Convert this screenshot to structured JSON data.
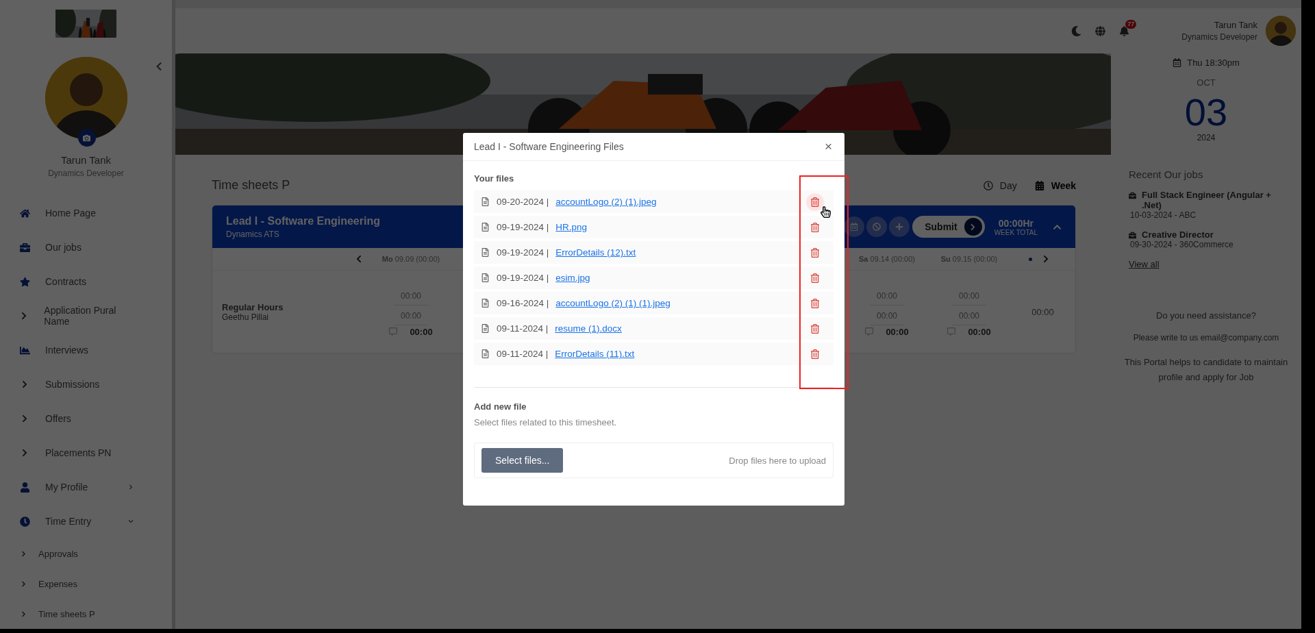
{
  "header": {
    "notification_count": "77",
    "user_name": "Tarun Tank",
    "user_role": "Dynamics Developer"
  },
  "sidebar": {
    "profile_name": "Tarun Tank",
    "profile_role": "Dynamics Developer",
    "items": [
      {
        "label": "Home Page",
        "kind": "home"
      },
      {
        "label": "Our jobs",
        "kind": "briefcase"
      },
      {
        "label": "Contracts",
        "kind": "star"
      },
      {
        "label": "Application Pural Name",
        "kind": "chevron"
      },
      {
        "label": "Interviews",
        "kind": "chart"
      },
      {
        "label": "Submissions",
        "kind": "chevron"
      },
      {
        "label": "Offers",
        "kind": "chevron"
      },
      {
        "label": "Placements PN",
        "kind": "chevron"
      },
      {
        "label": "My Profile",
        "kind": "user",
        "expanded": false
      },
      {
        "label": "Time Entry",
        "kind": "clock",
        "expanded": true,
        "children": [
          {
            "label": "Approvals"
          },
          {
            "label": "Expenses"
          },
          {
            "label": "Time sheets P"
          }
        ]
      }
    ]
  },
  "main": {
    "page_title": "Time sheets P",
    "view_toggle": [
      {
        "label": "Day",
        "selected": false
      },
      {
        "label": "Week",
        "selected": true
      }
    ],
    "timesheet": {
      "title": "Lead I - Software Engineering",
      "subtitle": "Dynamics ATS",
      "submit": "Submit",
      "week_total": "00:00Hr",
      "week_total_label": "WEEK TOTAL",
      "days": [
        {
          "abbr": "Mo",
          "date": "09.09 (00:00)"
        },
        {
          "abbr": "Sa",
          "date": "09.14 (00:00)"
        },
        {
          "abbr": "Su",
          "date": "09.15 (00:00)"
        }
      ],
      "row": {
        "label": "Regular Hours",
        "person": "Geethu Pillai",
        "cells": [
          {
            "start": "00:00",
            "end": "00:00",
            "hours": "00:00"
          },
          {
            "start": "00:00",
            "end": "00:00",
            "hours": "00:00"
          },
          {
            "start": "00:00",
            "end": "00:00",
            "hours": "00:00"
          }
        ],
        "total": "00:00"
      }
    }
  },
  "right_panel": {
    "time": "Thu 18:30pm",
    "month": "OCT",
    "day": "03",
    "year": "2024",
    "recent_title": "Recent Our jobs",
    "jobs": [
      {
        "title": "Full Stack Engineer (Angular + .Net)",
        "meta": "10-03-2024 - ABC"
      },
      {
        "title": "Creative Director",
        "meta": "09-30-2024 - 360Commerce"
      }
    ],
    "view_all": "View all",
    "assist_title": "Do you need assistance?",
    "assist_contact": "Please write to us email@company.com",
    "assist_note": "This Portal helps to candidate to maintain profile and apply for Job"
  },
  "modal": {
    "title": "Lead I - Software Engineering Files",
    "close": "×",
    "files_label": "Your files",
    "files": [
      {
        "date": "09-20-2024 |",
        "name": "accountLogo (2) (1).jpeg",
        "hovered": true
      },
      {
        "date": "09-19-2024 |",
        "name": "HR.png",
        "hovered": false
      },
      {
        "date": "09-19-2024 |",
        "name": "ErrorDetails (12).txt",
        "hovered": false
      },
      {
        "date": "09-19-2024 |",
        "name": "esim.jpg",
        "hovered": false
      },
      {
        "date": "09-16-2024 |",
        "name": "accountLogo (2) (1) (1).jpeg",
        "hovered": false
      },
      {
        "date": "09-11-2024 |",
        "name": "resume (1).docx",
        "hovered": false
      },
      {
        "date": "09-11-2024 |",
        "name": "ErrorDetails (11).txt",
        "hovered": false
      }
    ],
    "add_label": "Add new file",
    "add_hint": "Select files related to this timesheet.",
    "select_button": "Select files...",
    "drop_hint": "Drop files here to upload"
  }
}
